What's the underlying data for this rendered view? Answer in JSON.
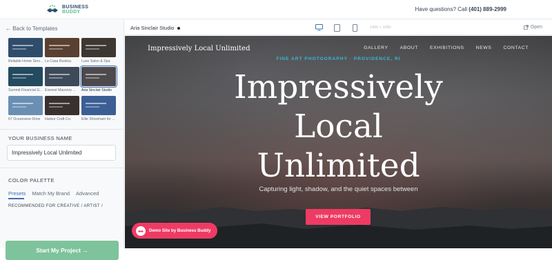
{
  "header": {
    "brand_line1": "BUSINESS",
    "brand_line2": "BUDDY",
    "phone_prefix": "Have questions? Call",
    "phone_number": "(401) 889-2999"
  },
  "sidebar": {
    "back_link": "← Back to Templates",
    "templates": [
      {
        "caption": "Reliable Home Serv...",
        "color": "#2f4d6b"
      },
      {
        "caption": "La Casa Rustica",
        "color": "#5a4030"
      },
      {
        "caption": "Luxe Salon & Spa",
        "color": "#3d3732"
      },
      {
        "caption": "Summit Financial G...",
        "color": "#234a5e"
      },
      {
        "caption": "Everest Masonry ...",
        "color": "#3c4a5a"
      },
      {
        "caption": "Aria Sinclair Studio",
        "color": "#4d4a4d",
        "selected": true
      },
      {
        "caption": "67 Oceanview Drive",
        "color": "#6a8fb3"
      },
      {
        "caption": "Harbor Craft Co.",
        "color": "#3a3030"
      },
      {
        "caption": "Ellie Shoreham for ...",
        "color": "#3b5f95"
      }
    ],
    "business_name_label": "YOUR BUSINESS NAME",
    "business_name_value": "Impressively Local Unlimited",
    "color_palette_label": "COLOR PALETTE",
    "palette_tabs": [
      "Presets",
      "Match My Brand",
      "Advanced"
    ],
    "recommended_label": "RECOMMENDED FOR CREATIVE / ARTIST /",
    "start_button": "Start My Project →"
  },
  "preview_bar": {
    "site_title": "Aria Sinclair Studio",
    "dimensions": "1400 × 1080",
    "open_label": "Open"
  },
  "hero": {
    "brand": "Impressively Local Unlimited",
    "nav": [
      "GALLERY",
      "ABOUT",
      "EXHIBITIONS",
      "NEWS",
      "CONTACT"
    ],
    "kicker": "FINE ART PHOTOGRAPHY · PROVIDENCE, RI",
    "title_line1": "Impressively",
    "title_line2": "Local",
    "title_line3": "Unlimited",
    "subtitle": "Capturing light, shadow, and the quiet spaces between",
    "cta": "VIEW PORTFOLIO",
    "demo_badge": "Demo Site by Business Buddy"
  },
  "colors": {
    "accent": "#ee3b64",
    "kicker": "#35b9d8",
    "start_button": "#7ec39c",
    "link": "#3a6fb7"
  }
}
